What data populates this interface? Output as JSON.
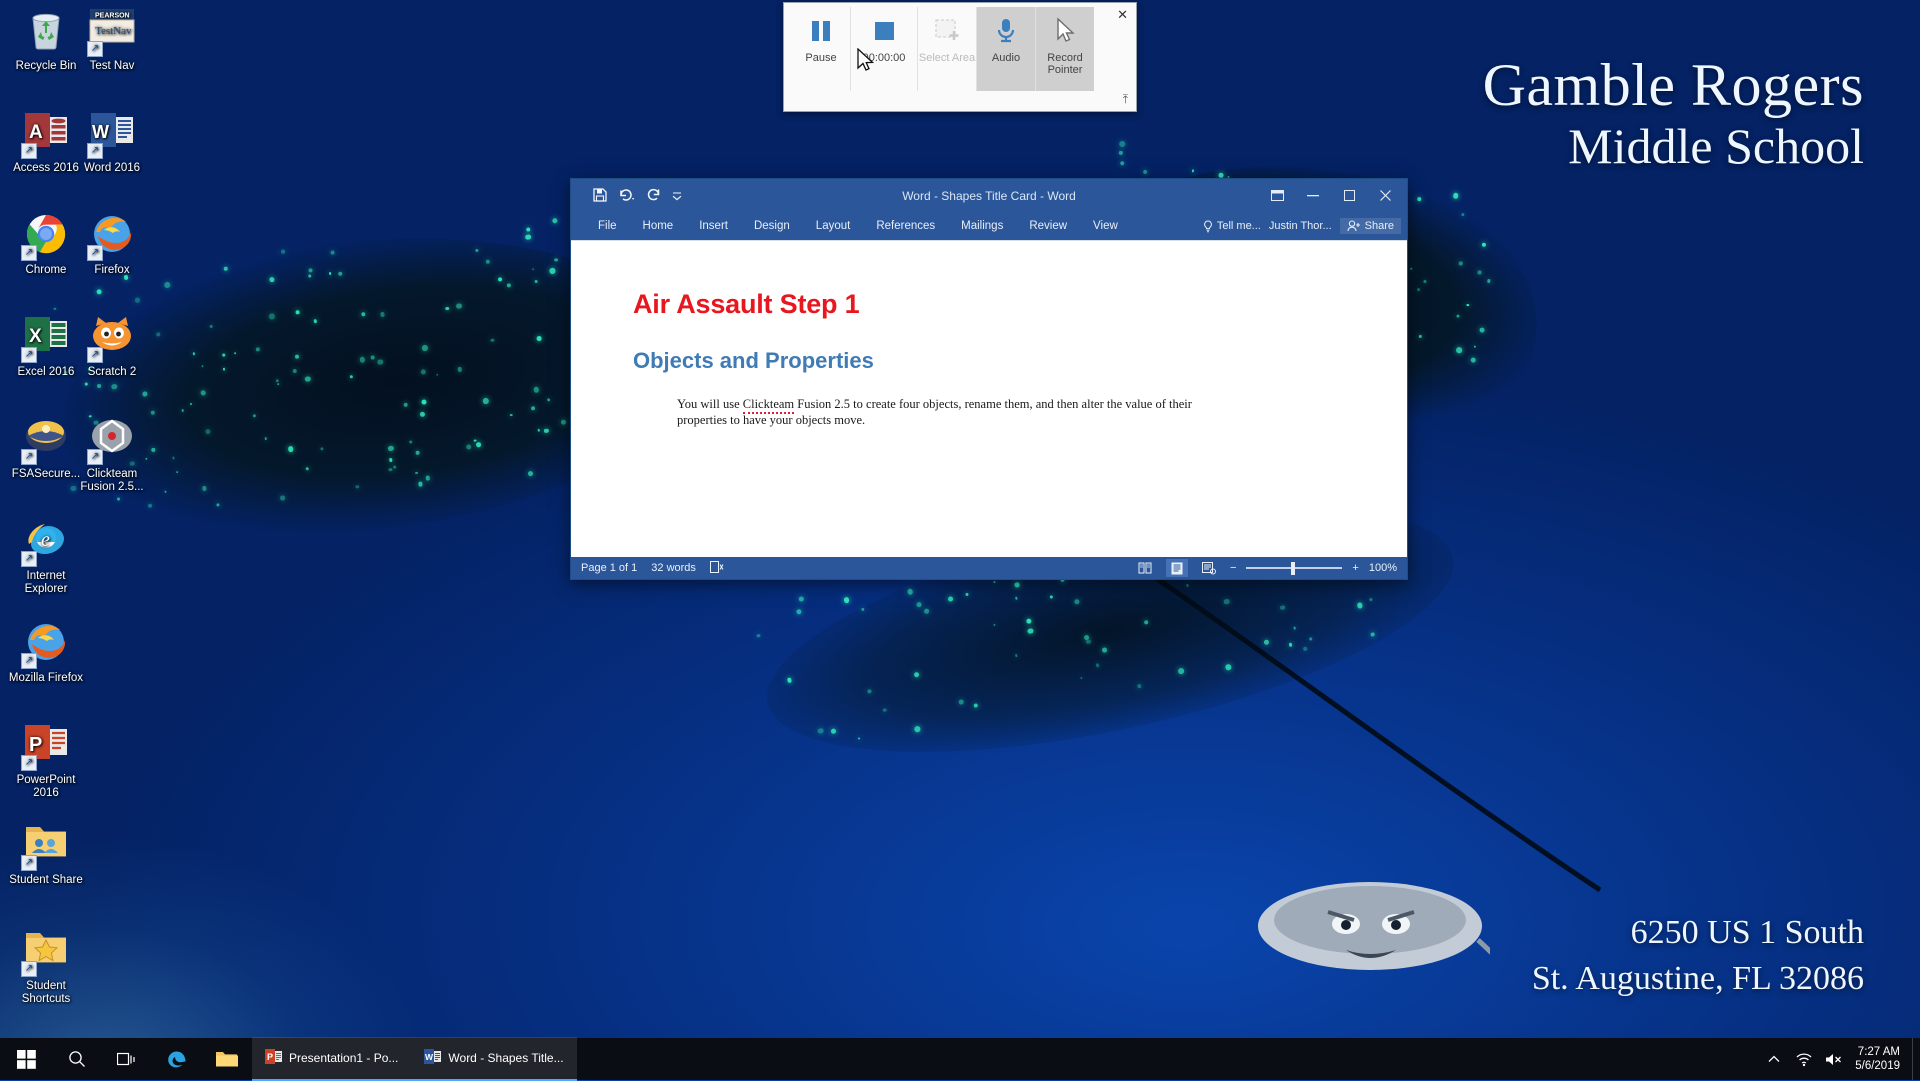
{
  "wallpaper": {
    "school_name_line1": "Gamble Rogers",
    "school_name_line2": "Middle School",
    "address_line1": "6250 US 1 South",
    "address_line2": "St. Augustine, FL 32086",
    "background_color": "#0b3ca8"
  },
  "desktop_icons": [
    {
      "label": "Recycle Bin",
      "icon": "recycle-bin-icon",
      "shortcut": false
    },
    {
      "label": "Test Nav",
      "icon": "testnav-icon",
      "shortcut": true
    },
    {
      "label": "Access 2016",
      "icon": "access-icon",
      "shortcut": true
    },
    {
      "label": "Word 2016",
      "icon": "word-icon",
      "shortcut": true
    },
    {
      "label": "Chrome",
      "icon": "chrome-icon",
      "shortcut": true
    },
    {
      "label": "Firefox",
      "icon": "firefox-icon",
      "shortcut": true
    },
    {
      "label": "Excel 2016",
      "icon": "excel-icon",
      "shortcut": true
    },
    {
      "label": "Scratch 2",
      "icon": "scratch-icon",
      "shortcut": true
    },
    {
      "label": "FSASecure...",
      "icon": "fsasecure-icon",
      "shortcut": true
    },
    {
      "label": "Clickteam Fusion 2.5...",
      "icon": "clickteam-fusion-icon",
      "shortcut": true
    },
    {
      "label": "Internet Explorer",
      "icon": "internet-explorer-icon",
      "shortcut": true
    },
    {
      "label": "Mozilla Firefox",
      "icon": "firefox-icon",
      "shortcut": true
    },
    {
      "label": "PowerPoint 2016",
      "icon": "powerpoint-icon",
      "shortcut": true
    },
    {
      "label": "Student Share",
      "icon": "folder-share-icon",
      "shortcut": true
    },
    {
      "label": "Student Shortcuts",
      "icon": "folder-shortcuts-icon",
      "shortcut": true
    }
  ],
  "recorder": {
    "pause_label": "Pause",
    "timer": "00:00:00",
    "select_area_label": "Select Area",
    "audio_label": "Audio",
    "record_pointer_label": "Record Pointer",
    "close_label": "✕",
    "pin_label": "⤒"
  },
  "word": {
    "title": "Word - Shapes Title Card - Word",
    "qat": [
      "save-icon",
      "undo-icon",
      "redo-icon",
      "customize-qat-icon"
    ],
    "tabs": [
      {
        "label": "File"
      },
      {
        "label": "Home"
      },
      {
        "label": "Insert"
      },
      {
        "label": "Design"
      },
      {
        "label": "Layout"
      },
      {
        "label": "References"
      },
      {
        "label": "Mailings"
      },
      {
        "label": "Review"
      },
      {
        "label": "View"
      }
    ],
    "tell_me": "Tell me...",
    "account_name": "Justin Thor...",
    "share_label": "Share",
    "window_controls": {
      "ribbon_options": "⬚",
      "minimize": "–",
      "maximize": "☐",
      "close": "✕"
    },
    "document": {
      "heading1": "Air Assault Step 1",
      "heading2": "Objects and Properties",
      "paragraph_pre": "You will use ",
      "paragraph_misspelled": "Clickteam",
      "paragraph_post": " Fusion 2.5 to create four objects, rename them, and then alter the value of their properties to have your objects move.",
      "heading1_color": "#e8171f",
      "heading2_color": "#3f7bb5"
    },
    "status": {
      "page": "Page 1 of 1",
      "words": "32 words",
      "proofing_icon": "proofing-errors-icon",
      "read_mode_icon": "read-mode-icon",
      "print_layout_icon": "print-layout-icon",
      "web_layout_icon": "web-layout-icon",
      "zoom_out": "−",
      "zoom_in": "+",
      "zoom_level": "100%"
    }
  },
  "taskbar": {
    "start_icon": "windows-start-icon",
    "search_icon": "search-icon",
    "task_view_icon": "task-view-icon",
    "pinned": [
      {
        "label": "Microsoft Edge",
        "icon": "edge-icon"
      },
      {
        "label": "File Explorer",
        "icon": "file-explorer-icon"
      }
    ],
    "tasks": [
      {
        "label": "Presentation1 - Po...",
        "icon": "powerpoint-icon",
        "active": true
      },
      {
        "label": "Word - Shapes Title...",
        "icon": "word-icon",
        "active": true
      }
    ],
    "tray": [
      {
        "name": "show-hidden-icons",
        "glyph": "⌃"
      },
      {
        "name": "network-wifi-icon",
        "glyph": "wifi"
      },
      {
        "name": "volume-muted-icon",
        "glyph": "mute"
      }
    ],
    "clock_time": "7:27 AM",
    "clock_date": "5/6/2019"
  }
}
